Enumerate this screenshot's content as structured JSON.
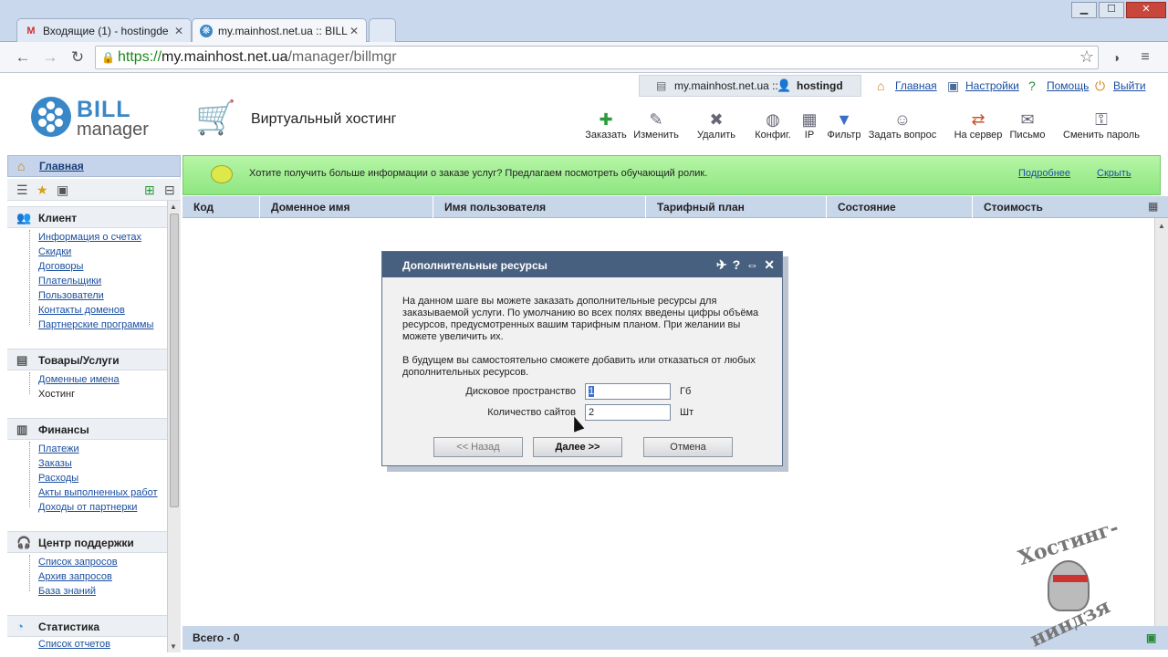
{
  "browser": {
    "tabs": [
      {
        "title": "Входящие (1) - hostingde",
        "icon": "gmail-icon"
      },
      {
        "title": "my.mainhost.net.ua :: BILL",
        "icon": "billmanager-icon"
      }
    ],
    "url": {
      "scheme": "https://",
      "host": "my.mainhost.net.ua",
      "path": "/manager/billmgr"
    }
  },
  "userbar": {
    "host": "my.mainhost.net.ua ::",
    "user": "hostingd",
    "links": [
      "Главная",
      "Настройки",
      "Помощь",
      "Выйти"
    ]
  },
  "header": {
    "logo_top": "BILL",
    "logo_bottom": "manager",
    "title": "Виртуальный хостинг"
  },
  "toolbar": [
    "Заказать",
    "Изменить",
    "Удалить",
    "Конфиг.",
    "IP",
    "Фильтр",
    "Задать вопрос",
    "На сервер",
    "Письмо",
    "Сменить пароль"
  ],
  "sidebar": {
    "home": "Главная",
    "sections": [
      {
        "title": "Клиент",
        "items": [
          "Информация о счетах",
          "Скидки",
          "Договоры",
          "Плательщики",
          "Пользователи",
          "Контакты доменов",
          "Партнерские программы"
        ]
      },
      {
        "title": "Товары/Услуги",
        "items": [
          "Доменные имена",
          "Хостинг"
        ]
      },
      {
        "title": "Финансы",
        "items": [
          "Платежи",
          "Заказы",
          "Расходы",
          "Акты выполненных работ",
          "Доходы от партнерки"
        ]
      },
      {
        "title": "Центр поддержки",
        "items": [
          "Список запросов",
          "Архив запросов",
          "База знаний"
        ]
      },
      {
        "title": "Статистика",
        "items": [
          "Список отчетов"
        ]
      }
    ]
  },
  "infobar": {
    "message": "Хотите получить больше информации о заказе услуг? Предлагаем посмотреть обучающий ролик.",
    "more": "Подробнее",
    "hide": "Скрыть"
  },
  "table": {
    "columns": [
      "Код",
      "Доменное имя",
      "Имя пользователя",
      "Тарифный план",
      "Состояние",
      "Стоимость"
    ],
    "total": "Всего - 0"
  },
  "dialog": {
    "title": "Дополнительные ресурсы",
    "p1": "На данном шаге вы можете заказать дополнительные ресурсы для заказываемой услуги. По умолчанию во всех полях введены цифры объёма ресурсов, предусмотренных вашим тарифным планом. При желании вы можете увеличить их.",
    "p2": "В будущем вы самостоятельно сможете добавить или отказаться от любых дополнительных ресурсов.",
    "fields": [
      {
        "label": "Дисковое пространство",
        "value": "1",
        "unit": "Гб"
      },
      {
        "label": "Количество сайтов",
        "value": "2",
        "unit": "Шт"
      }
    ],
    "buttons": {
      "back": "<< Назад",
      "next": "Далее >>",
      "cancel": "Отмена"
    }
  },
  "watermark": {
    "line1": "Хостинг-",
    "line2": "ниндзя"
  }
}
